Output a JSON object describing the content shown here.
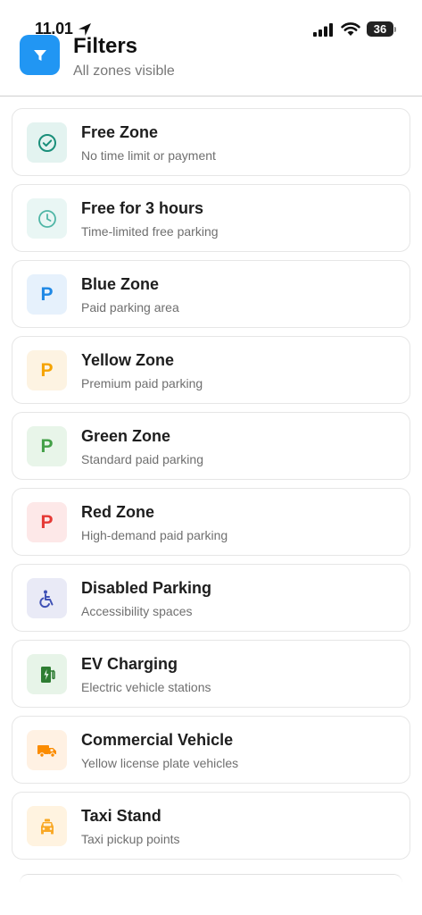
{
  "status_bar": {
    "time": "11.01",
    "battery_level": "36",
    "icons": [
      "location-arrow-icon",
      "signal-icon",
      "wifi-icon",
      "battery-icon"
    ]
  },
  "header": {
    "title": "Filters",
    "subtitle": "All zones visible",
    "icon": "filter-icon",
    "accent_color": "#2196f3"
  },
  "zones": [
    {
      "title": "Free Zone",
      "description": "No time limit or payment",
      "icon": "check-circle-icon",
      "color": "#1a8f7a",
      "bg": "#e3f3f0"
    },
    {
      "title": "Free for 3 hours",
      "description": "Time-limited free parking",
      "icon": "clock-icon",
      "color": "#4fb6a6",
      "bg": "#e9f6f4"
    },
    {
      "title": "Blue Zone",
      "description": "Paid parking area",
      "icon": "parking-p-icon",
      "letter": "P",
      "color": "#1e88e5",
      "bg": "#e6f1fc"
    },
    {
      "title": "Yellow Zone",
      "description": "Premium paid parking",
      "icon": "parking-p-icon",
      "letter": "P",
      "color": "#f5a300",
      "bg": "#fdf3e2"
    },
    {
      "title": "Green Zone",
      "description": "Standard paid parking",
      "icon": "parking-p-icon",
      "letter": "P",
      "color": "#43a047",
      "bg": "#e8f5e9"
    },
    {
      "title": "Red Zone",
      "description": "High-demand paid parking",
      "icon": "parking-p-icon",
      "letter": "P",
      "color": "#e53935",
      "bg": "#fde8e8"
    },
    {
      "title": "Disabled Parking",
      "description": "Accessibility spaces",
      "icon": "accessible-icon",
      "color": "#3f51b5",
      "bg": "#e9eaf6"
    },
    {
      "title": "EV Charging",
      "description": "Electric vehicle stations",
      "icon": "ev-charging-icon",
      "color": "#2e7d32",
      "bg": "#e7f4e8"
    },
    {
      "title": "Commercial Vehicle",
      "description": "Yellow license plate vehicles",
      "icon": "truck-icon",
      "color": "#fb8c00",
      "bg": "#fff1e3"
    },
    {
      "title": "Taxi Stand",
      "description": "Taxi pickup points",
      "icon": "taxi-icon",
      "color": "#f9a825",
      "bg": "#fff3e0"
    }
  ]
}
